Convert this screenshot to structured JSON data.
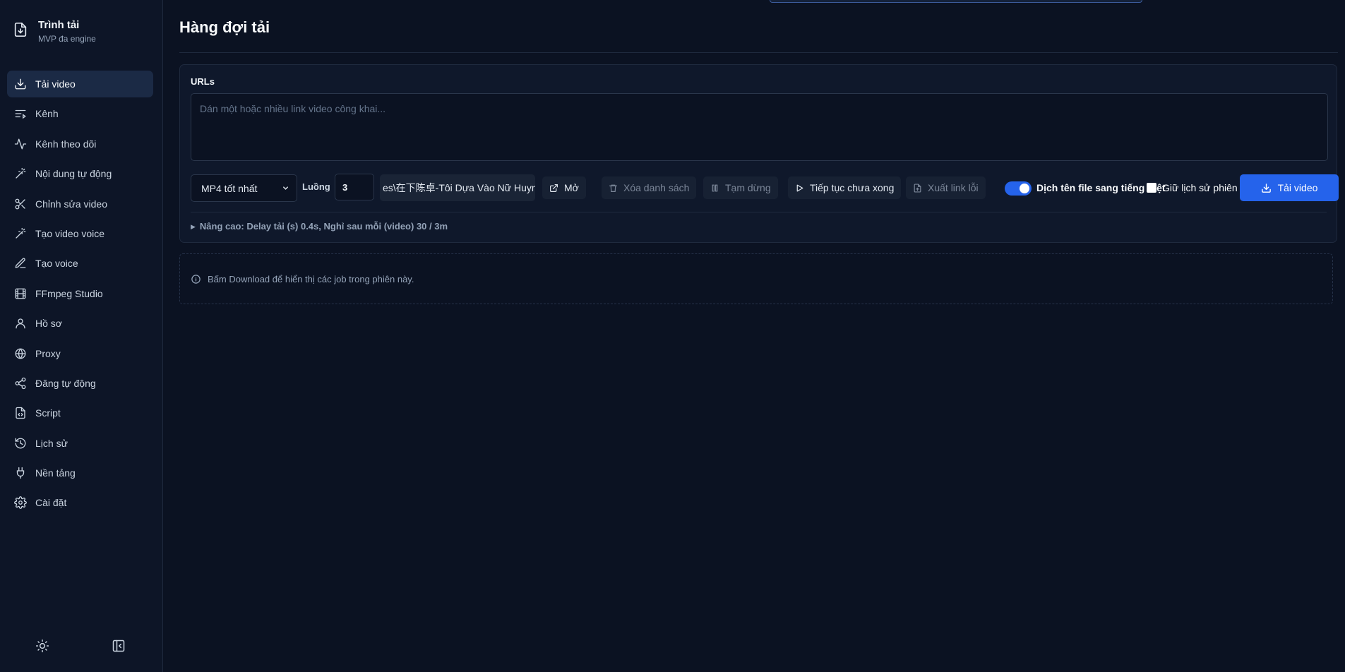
{
  "brand": {
    "title": "Trình tải",
    "subtitle": "MVP đa engine"
  },
  "sidebar": {
    "items": [
      {
        "label": "Tải video",
        "icon": "download-icon",
        "active": true
      },
      {
        "label": "Kênh",
        "icon": "list-icon"
      },
      {
        "label": "Kênh theo dõi",
        "icon": "activity-icon"
      },
      {
        "label": "Nội dung tự động",
        "icon": "wand-icon"
      },
      {
        "label": "Chỉnh sửa video",
        "icon": "scissors-icon"
      },
      {
        "label": "Tạo video voice",
        "icon": "wand-icon"
      },
      {
        "label": "Tạo voice",
        "icon": "pen-icon"
      },
      {
        "label": "FFmpeg Studio",
        "icon": "film-icon"
      },
      {
        "label": "Hồ sơ",
        "icon": "user-icon"
      },
      {
        "label": "Proxy",
        "icon": "globe-icon"
      },
      {
        "label": "Đăng tự động",
        "icon": "share-icon"
      },
      {
        "label": "Script",
        "icon": "file-code-icon"
      },
      {
        "label": "Lịch sử",
        "icon": "history-icon"
      },
      {
        "label": "Nền tảng",
        "icon": "plug-icon"
      },
      {
        "label": "Cài đặt",
        "icon": "gear-icon"
      }
    ],
    "bottom_icons": [
      "sun-icon",
      "collapse-sidebar-icon"
    ]
  },
  "main": {
    "title": "Hàng đợi tải",
    "urls_label": "URLs",
    "urls_placeholder": "Dán một hoặc nhiều link video công khai...",
    "format_value": "MP4 tốt nhất",
    "threads_label": "Luồng",
    "threads_value": "3",
    "path_value": "es\\在下陈卓-Tôi Dựa Vào Nữ Huynh",
    "buttons": {
      "open": "Mở",
      "clear": "Xóa danh sách",
      "pause": "Tạm dừng",
      "resume": "Tiếp tục chưa xong",
      "export": "Xuất link lỗi"
    },
    "translate_toggle_label": "Dịch tên file sang tiếng Việt",
    "translate_toggle_on": true,
    "keep_history_label": "Giữ lịch sử phiên",
    "keep_history_checked": false,
    "download_button": "Tải video",
    "advanced_label": "Nâng cao: Delay tải (s) 0.4s, Nghỉ sau mỗi (video) 30 / 3m",
    "info_text": "Bấm Download để hiển thị các job trong phiên này."
  },
  "colors": {
    "accent": "#2563eb",
    "background": "#0b1222",
    "sidebar": "#0d1527"
  }
}
